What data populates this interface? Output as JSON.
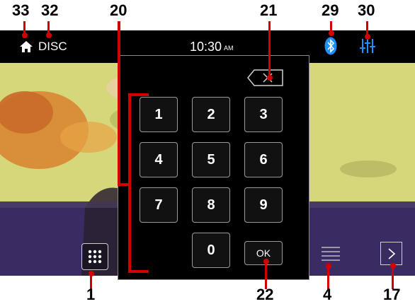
{
  "header": {
    "source_label": "DISC",
    "time": "10:30",
    "ampm": "AM"
  },
  "keypad": {
    "keys": [
      "1",
      "2",
      "3",
      "4",
      "5",
      "6",
      "7",
      "8",
      "9",
      "0"
    ],
    "ok_label": "OK"
  },
  "callouts": {
    "home": "33",
    "source": "32",
    "keypad": "20",
    "backspace": "21",
    "bluetooth": "29",
    "settings": "30",
    "grid": "1",
    "ok": "22",
    "list": "4",
    "next": "17"
  },
  "colors": {
    "accent_blue": "#1e90ff",
    "callout_red": "#d20000",
    "video_upper": "#d6d67a",
    "video_lower": "#3b2b63"
  },
  "icons": [
    "home-icon",
    "bluetooth-icon",
    "equalizer-icon",
    "backspace-icon",
    "grid-icon",
    "list-icon",
    "chevron-right-icon"
  ]
}
